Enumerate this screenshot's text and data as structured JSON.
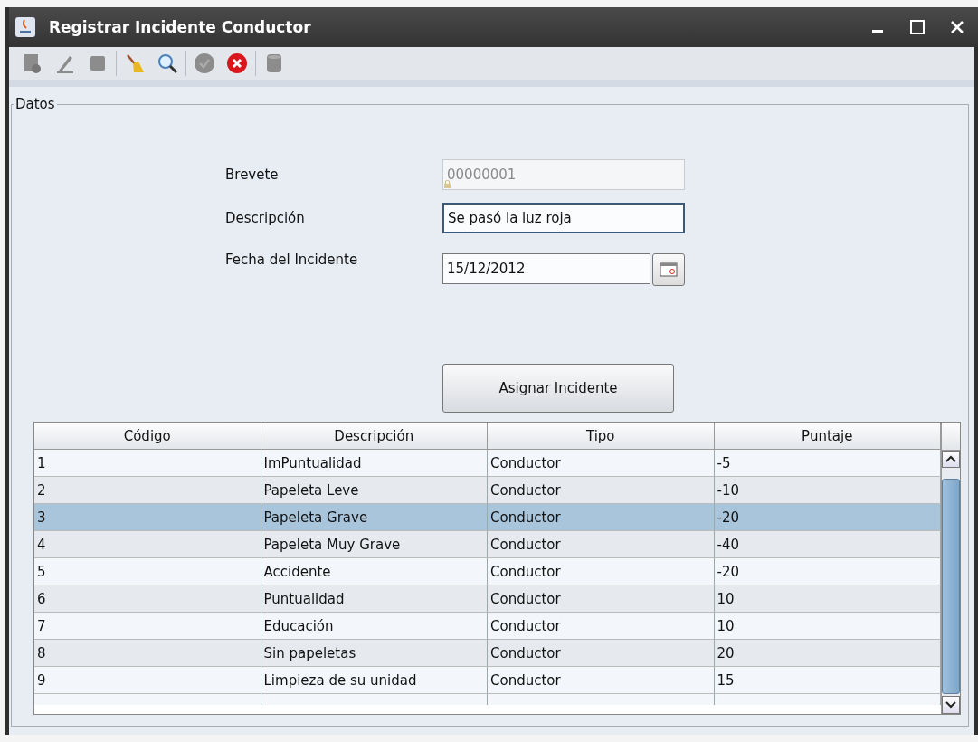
{
  "window": {
    "title": "Registrar Incidente Conductor",
    "controls": [
      {
        "kind": "minimize"
      },
      {
        "kind": "maximize"
      },
      {
        "kind": "close"
      }
    ]
  },
  "toolbar": {
    "groups": [
      {
        "tools": [
          {
            "kind": "new",
            "disabled": true
          },
          {
            "kind": "edit",
            "disabled": true
          },
          {
            "kind": "save",
            "disabled": true
          }
        ]
      },
      {
        "tools": [
          {
            "kind": "clear",
            "disabled": false
          },
          {
            "kind": "search",
            "disabled": false
          }
        ]
      },
      {
        "tools": [
          {
            "kind": "accept",
            "disabled": true
          },
          {
            "kind": "cancel",
            "disabled": false
          }
        ]
      },
      {
        "tools": [
          {
            "kind": "delete",
            "disabled": true
          }
        ]
      }
    ]
  },
  "panel": {
    "title": "Datos",
    "fields": [
      {
        "kind": "text",
        "label": "Brevete",
        "value": "00000001",
        "disabled": true,
        "focused": false
      },
      {
        "kind": "text",
        "label": "Descripción",
        "value": "Se pasó la luz roja",
        "disabled": false,
        "focused": true
      },
      {
        "kind": "date",
        "label": "Fecha del Incidente",
        "value": "15/12/2012",
        "disabled": false,
        "focused": false
      }
    ],
    "button": "Asignar Incidente"
  },
  "table": {
    "columns": [
      "Código",
      "Descripción",
      "Tipo",
      "Puntaje"
    ],
    "rows": [
      {
        "cells": [
          "1",
          "ImPuntualidad",
          "Conductor",
          "-5"
        ],
        "selected": false
      },
      {
        "cells": [
          "2",
          "Papeleta Leve",
          "Conductor",
          "-10"
        ],
        "selected": false
      },
      {
        "cells": [
          "3",
          "Papeleta Grave",
          "Conductor",
          "-20"
        ],
        "selected": true
      },
      {
        "cells": [
          "4",
          "Papeleta Muy Grave",
          "Conductor",
          "-40"
        ],
        "selected": false
      },
      {
        "cells": [
          "5",
          "Accidente",
          "Conductor",
          "-20"
        ],
        "selected": false
      },
      {
        "cells": [
          "6",
          "Puntualidad",
          "Conductor",
          "10"
        ],
        "selected": false
      },
      {
        "cells": [
          "7",
          "Educación",
          "Conductor",
          "10"
        ],
        "selected": false
      },
      {
        "cells": [
          "8",
          "Sin papeletas",
          "Conductor",
          "20"
        ],
        "selected": false
      },
      {
        "cells": [
          "9",
          "Limpieza de su unidad",
          "Conductor",
          "15"
        ],
        "selected": false
      }
    ]
  }
}
